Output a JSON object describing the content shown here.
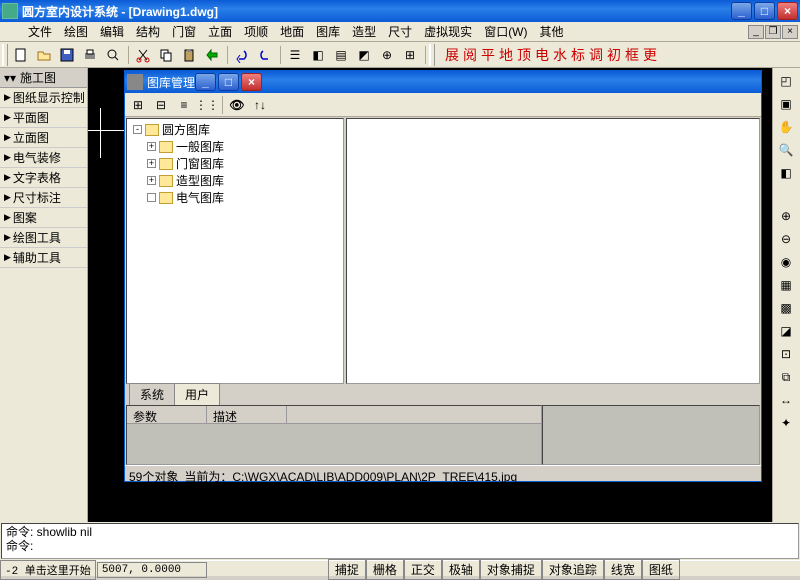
{
  "app": {
    "title": "圆方室内设计系统 - [Drawing1.dwg]"
  },
  "menu": {
    "items": [
      "文件",
      "绘图",
      "编辑",
      "结构",
      "门窗",
      "立面",
      "项顺",
      "地面",
      "图库",
      "造型",
      "尺寸",
      "虚拟现实",
      "窗口(W)",
      "其他"
    ]
  },
  "redtext": [
    "展",
    "阅",
    "平",
    "地",
    "顶",
    "电",
    "水",
    "标",
    "调",
    "初",
    "框",
    "更"
  ],
  "sidebar": {
    "header": "施工图",
    "items": [
      "图纸显示控制",
      "平面图",
      "立面图",
      "电气装修",
      "文字表格",
      "尺寸标注",
      "图案",
      "绘图工具",
      "辅助工具"
    ]
  },
  "dialog": {
    "title": "图库管理",
    "tree_root": "圆方图库",
    "tree_children": [
      "一般图库",
      "门窗图库",
      "造型图库",
      "电气图库"
    ],
    "tabs": [
      "系统",
      "用户"
    ],
    "param_headers": [
      "参数",
      "描述"
    ],
    "status_count": "59个对象",
    "status_path": "当前为：C:\\WGX\\ACAD\\LIB\\ADD009\\PLAN\\2P_TREE\\415.jpg"
  },
  "cmd": {
    "line1": "命令: showlib nil",
    "line2": "命令:"
  },
  "status": {
    "coord_label": "-2 单击这里开始",
    "coord": "5007, 0.0000",
    "buttons": [
      "捕捉",
      "栅格",
      "正交",
      "极轴",
      "对象捕捉",
      "对象追踪",
      "线宽",
      "图纸"
    ]
  }
}
